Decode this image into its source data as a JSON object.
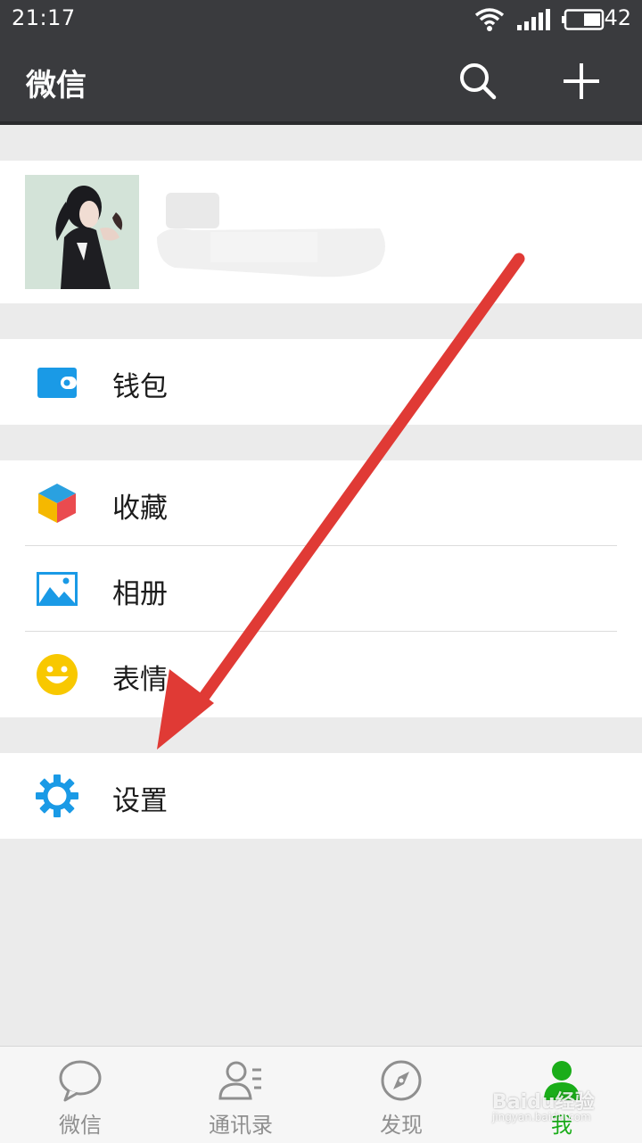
{
  "status_bar": {
    "time": "21:17",
    "battery": "42"
  },
  "header": {
    "title": "微信"
  },
  "menu": {
    "wallet": "钱包",
    "favorites": "收藏",
    "album": "相册",
    "stickers": "表情",
    "settings": "设置"
  },
  "tabs": [
    {
      "label": "微信"
    },
    {
      "label": "通讯录"
    },
    {
      "label": "发现"
    },
    {
      "label": "我"
    }
  ],
  "watermark": {
    "main": "Baidu经验",
    "sub": "jingyan.baidu.com"
  },
  "colors": {
    "header_bg": "#3a3b3e",
    "accent_green": "#1aad19",
    "icon_blue": "#1a9ae6",
    "arrow_red": "#e03a35"
  }
}
